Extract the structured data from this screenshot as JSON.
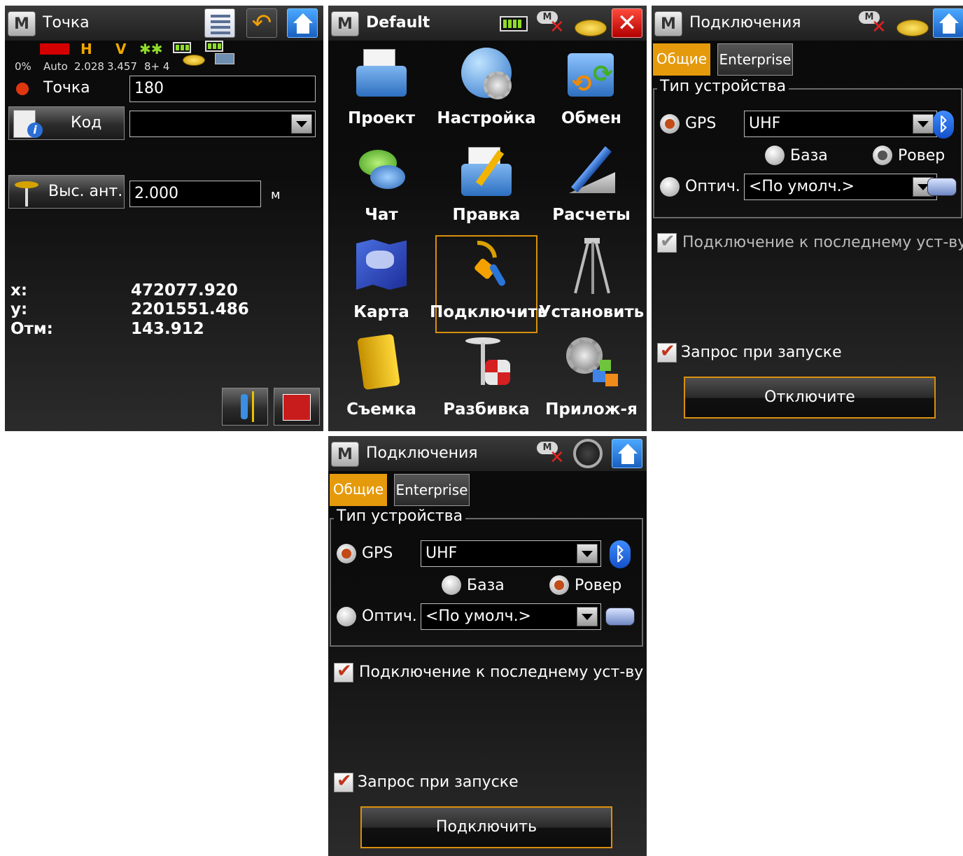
{
  "screen1": {
    "title": "Точка",
    "status": {
      "percent": "0%",
      "mode": "Auto",
      "h_label": "H",
      "v_label": "V",
      "h_value": "2.028",
      "v_value": "3.457",
      "sats": "8+ 4"
    },
    "point_label": "Точка",
    "point_value": "180",
    "code_button": "Код",
    "code_value": "",
    "antenna_button": "Выс. ант.",
    "antenna_value": "2.000",
    "antenna_unit": "м",
    "coords": [
      {
        "label": "x:",
        "value": "472077.920"
      },
      {
        "label": "y:",
        "value": "2201551.486"
      },
      {
        "label": "Отм:",
        "value": "143.912"
      }
    ]
  },
  "screen2": {
    "title": "Default",
    "menu": [
      {
        "label": "Проект",
        "icon": "folder-document-icon"
      },
      {
        "label": "Настройка",
        "icon": "globe-gear-icon"
      },
      {
        "label": "Обмен",
        "icon": "exchange-icon"
      },
      {
        "label": "Чат",
        "icon": "chat-bubbles-icon"
      },
      {
        "label": "Правка",
        "icon": "folder-pencil-icon"
      },
      {
        "label": "Расчеты",
        "icon": "pencil-ruler-icon"
      },
      {
        "label": "Карта",
        "icon": "world-map-icon"
      },
      {
        "label": "Подключить",
        "icon": "cable-plug-icon"
      },
      {
        "label": "Установить",
        "icon": "tripod-icon"
      },
      {
        "label": "Съемка",
        "icon": "notebook-icon"
      },
      {
        "label": "Разбивка",
        "icon": "stake-icon"
      },
      {
        "label": "Прилож-я",
        "icon": "gear-blocks-icon"
      }
    ]
  },
  "screen3": {
    "title": "Подключения",
    "tabs": [
      "Общие",
      "Enterprise"
    ],
    "group_title": "Тип устройства",
    "gps_label": "GPS",
    "gps_value": "UHF",
    "base_label": "База",
    "rover_label": "Ровер",
    "optic_label": "Оптич.",
    "optic_value": "<По умолч.>",
    "last_bt_label": "Подключение к последнему уст-ву BT",
    "startup_label": "Запрос при запуске",
    "action_button": "Отключите"
  },
  "screen4": {
    "title": "Подключения",
    "tabs": [
      "Общие",
      "Enterprise"
    ],
    "group_title": "Тип устройства",
    "gps_label": "GPS",
    "gps_value": "UHF",
    "base_label": "База",
    "rover_label": "Ровер",
    "optic_label": "Оптич.",
    "optic_value": "<По умолч.>",
    "last_bt_label": "Подключение к последнему уст-ву BT",
    "startup_label": "Запрос при запуске",
    "action_button": "Подключить"
  },
  "colors": {
    "accent": "#e59a0c",
    "radio_selected": "#c24b17",
    "home_blue": "#2f7fe0",
    "background": "#0d0d0d"
  }
}
